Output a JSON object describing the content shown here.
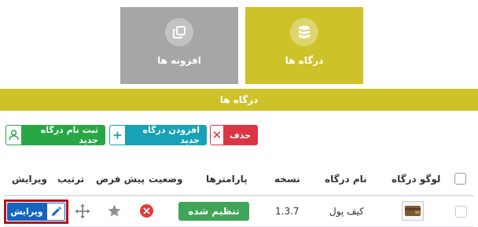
{
  "tiles": {
    "gateways": {
      "label": "درگاه ها",
      "icon": "database-icon"
    },
    "addons": {
      "label": "افزونه ها",
      "icon": "copy-icon"
    }
  },
  "band": {
    "title": "درگاه ها"
  },
  "actions": {
    "delete_label": "حذف",
    "add_label": "افزودن درگاه جدید",
    "register_label": "ثبت نام درگاه جدید"
  },
  "table": {
    "headers": {
      "logo": "لوگو درگاه",
      "name": "نام درگاه",
      "version": "نسخه",
      "params": "پارامترها",
      "status": "وضعیت",
      "default": "پیش فرض",
      "order": "ترتیب",
      "edit": "ویرایش"
    },
    "rows": [
      {
        "name": "کیف پول",
        "version": "1.3.7",
        "params_label": "تنظیم شده",
        "edit_label": "ویرایش"
      }
    ]
  },
  "colors": {
    "accent": "#cec22a",
    "tile_inactive": "#a6a6a6",
    "danger": "#dc3545",
    "info": "#17a2b8",
    "success": "#28a745",
    "edit_blue": "#1565c0",
    "highlight_border": "#b0141c"
  }
}
